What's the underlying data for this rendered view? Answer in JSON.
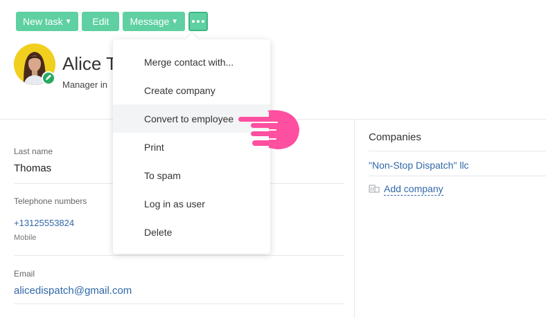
{
  "toolbar": {
    "new_task_label": "New task",
    "edit_label": "Edit",
    "message_label": "Message"
  },
  "contact": {
    "name": "Alice T",
    "position": "Manager in"
  },
  "fields": {
    "last_name_label": "Last name",
    "last_name_value": "Thomas",
    "phone_label": "Telephone numbers",
    "phone_value": "+13125553824",
    "phone_type": "Mobile",
    "email_label": "Email",
    "email_value": "alicedispatch@gmail.com"
  },
  "companies": {
    "title": "Companies",
    "items": [
      "\"Non-Stop Dispatch\" llc"
    ],
    "add_label": "Add company"
  },
  "menu": {
    "items": [
      {
        "label": "Merge contact with..."
      },
      {
        "label": "Create company"
      },
      {
        "label": "Convert to employee"
      },
      {
        "label": "Print"
      },
      {
        "label": "To spam"
      },
      {
        "label": "Log in as user"
      },
      {
        "label": "Delete"
      }
    ],
    "hovered_index": 2
  },
  "icons": {
    "more": "more-dots-icon",
    "edit_avatar": "pencil-icon",
    "add_company": "building-icon",
    "pointer": "pointing-hand-icon"
  },
  "colors": {
    "toolbar_button": "#5fd0a1",
    "link": "#2f67a8",
    "avatar_bg": "#f1cf1f",
    "pointer": "#ff4fa0"
  }
}
